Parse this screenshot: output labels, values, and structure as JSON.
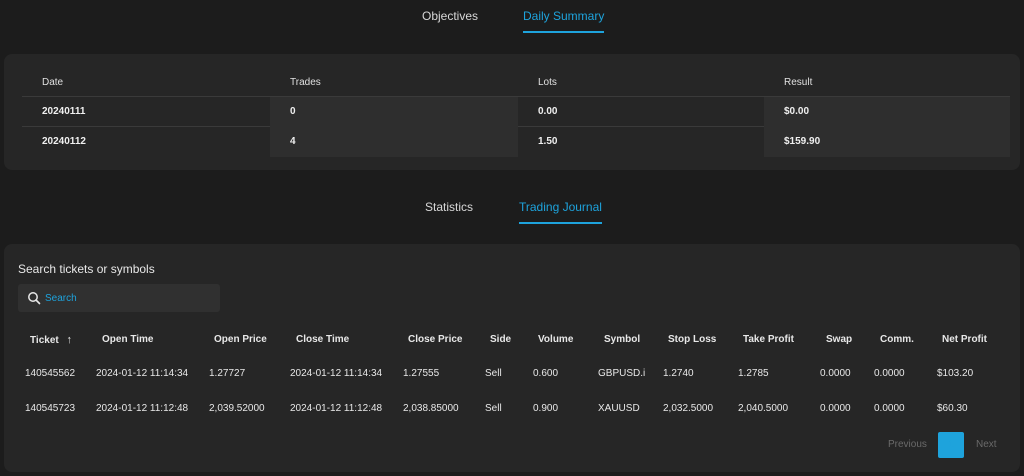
{
  "top_tabs": [
    {
      "label": "Objectives",
      "active": false
    },
    {
      "label": "Daily Summary",
      "active": true
    }
  ],
  "summary": {
    "headers": [
      "Date",
      "Trades",
      "Lots",
      "Result"
    ],
    "rows": [
      [
        "20240111",
        "0",
        "0.00",
        "$0.00"
      ],
      [
        "20240112",
        "4",
        "1.50",
        "$159.90"
      ]
    ]
  },
  "sub_tabs": [
    {
      "label": "Statistics",
      "active": false
    },
    {
      "label": "Trading Journal",
      "active": true
    }
  ],
  "journal": {
    "search_label": "Search tickets or symbols",
    "search_placeholder": "Search",
    "headers": [
      "Ticket",
      "Open Time",
      "Open Price",
      "Close Time",
      "Close Price",
      "Side",
      "Volume",
      "Symbol",
      "Stop Loss",
      "Take Profit",
      "Swap",
      "Comm.",
      "Net Profit"
    ],
    "sort_indicator": "↑",
    "rows": [
      [
        "140545562",
        "2024-01-12 11:14:34",
        "1.27727",
        "2024-01-12 11:14:34",
        "1.27555",
        "Sell",
        "0.600",
        "GBPUSD.i",
        "1.2740",
        "1.2785",
        "0.0000",
        "0.0000",
        "$103.20"
      ],
      [
        "140545723",
        "2024-01-12 11:12:48",
        "2,039.52000",
        "2024-01-12 11:12:48",
        "2,038.85000",
        "Sell",
        "0.900",
        "XAUUSD",
        "2,032.5000",
        "2,040.5000",
        "0.0000",
        "0.0000",
        "$60.30"
      ]
    ]
  },
  "pagination": {
    "previous": "Previous",
    "page": "1",
    "next": "Next"
  },
  "colors": {
    "background": "#1c1c1c",
    "card": "#262626",
    "accent": "#1ea3dc"
  }
}
